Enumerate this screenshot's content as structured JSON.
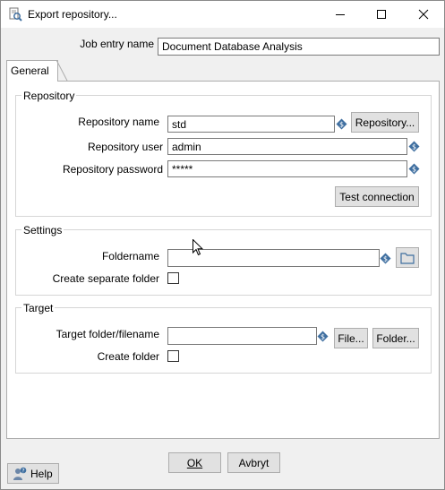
{
  "window": {
    "title": "Export repository...",
    "icon": "repository-export-icon"
  },
  "job_entry": {
    "label": "Job entry name",
    "value": "Document Database Analysis"
  },
  "tabs": [
    {
      "label": "General",
      "selected": true
    }
  ],
  "repository": {
    "group_title": "Repository",
    "name_label": "Repository name",
    "name_value": "std",
    "repository_button": "Repository...",
    "user_label": "Repository user",
    "user_value": "admin",
    "password_label": "Repository password",
    "password_value": "*****",
    "test_button": "Test connection"
  },
  "settings": {
    "group_title": "Settings",
    "foldername_label": "Foldername",
    "foldername_value": "",
    "separate_folder_label": "Create separate folder",
    "separate_folder_checked": false
  },
  "target": {
    "group_title": "Target",
    "filename_label": "Target folder/filename",
    "filename_value": "",
    "file_button": "File...",
    "folder_button": "Folder...",
    "create_folder_label": "Create folder",
    "create_folder_checked": false
  },
  "footer": {
    "ok_button": "OK",
    "cancel_button": "Avbryt",
    "help_button": "Help"
  },
  "colors": {
    "variable_icon": "#3f6fa0",
    "window_bg": "#f0f0f0",
    "button_bg": "#e1e1e1"
  }
}
